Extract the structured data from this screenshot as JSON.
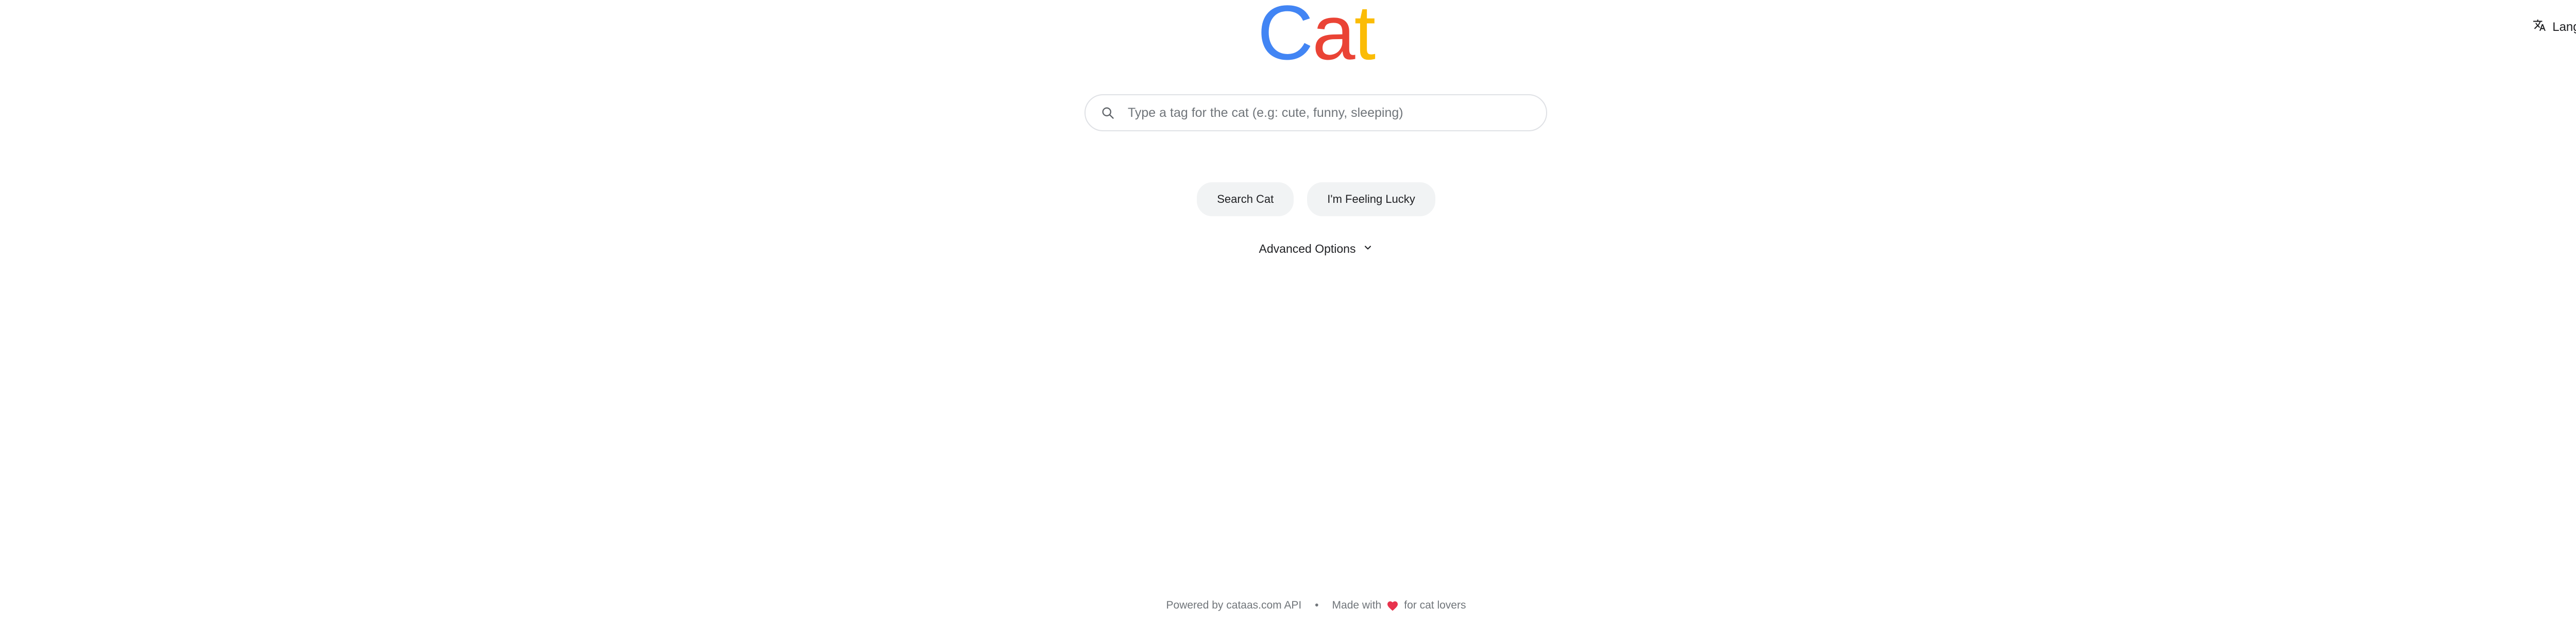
{
  "header": {
    "language_label": "Language"
  },
  "logo": {
    "letters": [
      {
        "char": "C",
        "color": "#4285f4"
      },
      {
        "char": "a",
        "color": "#ea4335"
      },
      {
        "char": "t",
        "color": "#fbbc05"
      }
    ]
  },
  "search": {
    "placeholder": "Type a tag for the cat (e.g: cute, funny, sleeping)",
    "value": ""
  },
  "buttons": {
    "search_label": "Search Cat",
    "lucky_label": "I'm Feeling Lucky"
  },
  "advanced": {
    "label": "Advanced Options"
  },
  "footer": {
    "powered_by": "Powered by cataas.com API",
    "separator": "•",
    "made_with": "Made with",
    "for_lovers": "for cat lovers",
    "heart_color": "#e8334d"
  },
  "icons": {
    "search": "search-icon",
    "language": "translate-icon",
    "chevron": "chevron-down-icon",
    "heart": "heart-icon"
  }
}
